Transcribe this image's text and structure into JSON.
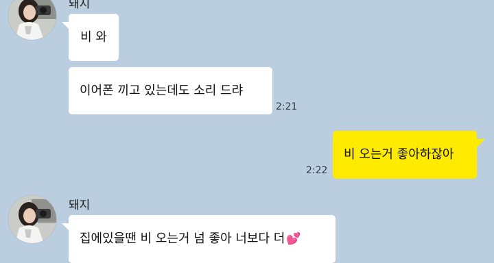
{
  "chat": {
    "messages": [
      {
        "sender": "돼지",
        "text": "비 와"
      },
      {
        "sender": "",
        "text": "이어폰 끼고 있는데도 소리 드랴",
        "time": "2:21"
      },
      {
        "sender": "me",
        "text": "비 오는거 좋아하잖아",
        "time": "2:22"
      },
      {
        "sender": "돼지",
        "text": "집에있을땐 비 오는거 넘 좋아 너보다 더",
        "emoji": "💕"
      }
    ]
  },
  "colors": {
    "background": "#BACEE0",
    "incoming_bubble": "#FFFFFF",
    "outgoing_bubble": "#FEEB00"
  },
  "icons": {
    "avatar": "profile-photo-avatar",
    "heart": "two-hearts-emoji"
  }
}
